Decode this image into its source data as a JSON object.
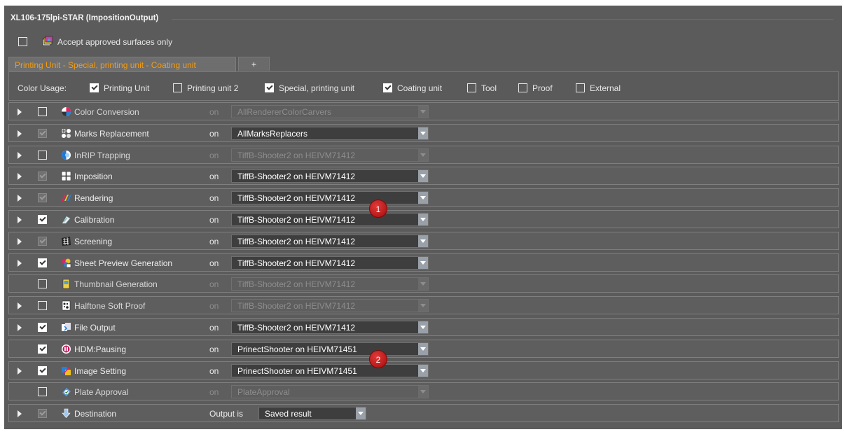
{
  "window": {
    "title": "XL106-175lpi-STAR (ImpositionOutput)"
  },
  "accept": {
    "label": "Accept approved surfaces only",
    "checked": false
  },
  "tabs": {
    "active_label": "Printing Unit  -  Special, printing unit  -  Coating unit",
    "add_label": "+"
  },
  "color_usage": {
    "label": "Color Usage:",
    "options": [
      {
        "label": "Printing Unit",
        "checked": true
      },
      {
        "label": "Printing unit 2",
        "checked": false
      },
      {
        "label": "Special, printing unit",
        "checked": true
      },
      {
        "label": "Coating unit",
        "checked": true
      },
      {
        "label": "Tool",
        "checked": false
      },
      {
        "label": "Proof",
        "checked": false
      },
      {
        "label": "External",
        "checked": false
      }
    ]
  },
  "rows": [
    {
      "name": "Color Conversion",
      "on": "on",
      "value": "AllRendererColorCarvers",
      "checked": false,
      "expandable": true,
      "enabled": false,
      "icon": "color-conversion-icon"
    },
    {
      "name": "Marks Replacement",
      "on": "on",
      "value": "AllMarksReplacers",
      "checked": true,
      "expandable": true,
      "enabled": true,
      "dim_check": true,
      "icon": "marks-replacement-icon"
    },
    {
      "name": "InRIP Trapping",
      "on": "on",
      "value": "TiffB-Shooter2 on HEIVM71412",
      "checked": false,
      "expandable": true,
      "enabled": false,
      "icon": "trapping-icon"
    },
    {
      "name": "Imposition",
      "on": "on",
      "value": "TiffB-Shooter2 on HEIVM71412",
      "checked": true,
      "expandable": true,
      "enabled": true,
      "dim_check": true,
      "icon": "imposition-icon"
    },
    {
      "name": "Rendering",
      "on": "on",
      "value": "TiffB-Shooter2 on HEIVM71412",
      "checked": true,
      "expandable": true,
      "enabled": true,
      "dim_check": true,
      "icon": "rendering-icon"
    },
    {
      "name": "Calibration",
      "on": "on",
      "value": "TiffB-Shooter2 on HEIVM71412",
      "checked": true,
      "expandable": true,
      "enabled": true,
      "icon": "calibration-icon"
    },
    {
      "name": "Screening",
      "on": "on",
      "value": "TiffB-Shooter2 on HEIVM71412",
      "checked": true,
      "expandable": true,
      "enabled": true,
      "dim_check": true,
      "icon": "screening-icon"
    },
    {
      "name": "Sheet Preview Generation",
      "on": "on",
      "value": "TiffB-Shooter2 on HEIVM71412",
      "checked": true,
      "expandable": true,
      "enabled": true,
      "icon": "sheet-preview-icon"
    },
    {
      "name": "Thumbnail Generation",
      "on": "on",
      "value": "TiffB-Shooter2 on HEIVM71412",
      "checked": false,
      "expandable": false,
      "enabled": false,
      "icon": "thumbnail-icon"
    },
    {
      "name": "Halftone Soft Proof",
      "on": "on",
      "value": "TiffB-Shooter2 on HEIVM71412",
      "checked": false,
      "expandable": true,
      "enabled": false,
      "icon": "halftone-proof-icon"
    },
    {
      "name": "File Output",
      "on": "on",
      "value": "TiffB-Shooter2 on HEIVM71412",
      "checked": true,
      "expandable": true,
      "enabled": true,
      "icon": "file-output-icon"
    },
    {
      "name": "HDM:Pausing",
      "on": "on",
      "value": "PrinectShooter on HEIVM71451",
      "checked": true,
      "expandable": false,
      "enabled": true,
      "icon": "pausing-icon"
    },
    {
      "name": "Image Setting",
      "on": "on",
      "value": "PrinectShooter on HEIVM71451",
      "checked": true,
      "expandable": true,
      "enabled": true,
      "icon": "image-setting-icon"
    },
    {
      "name": "Plate Approval",
      "on": "on",
      "value": "PlateApproval",
      "checked": false,
      "expandable": false,
      "enabled": false,
      "icon": "plate-approval-icon"
    }
  ],
  "destination": {
    "name": "Destination",
    "output_label": "Output is",
    "value": "Saved result",
    "checked": true,
    "icon": "destination-icon"
  },
  "badges": [
    "1",
    "2"
  ],
  "colors": {
    "accent_tab": "#f39c12",
    "badge": "#c0151b",
    "panel": "#5b5b5b"
  }
}
